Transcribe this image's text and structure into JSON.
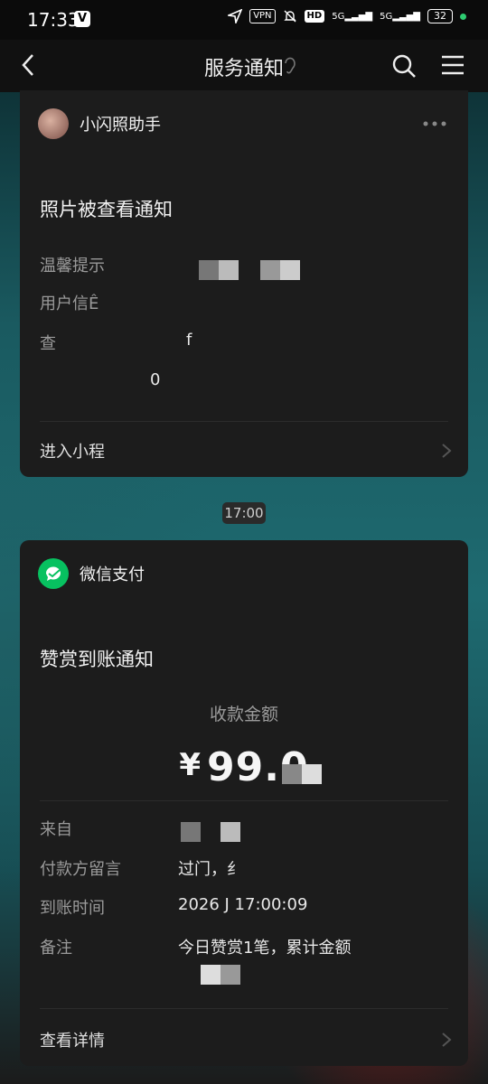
{
  "status_bar": {
    "time": "17:33",
    "app_badge": "V",
    "vpn": "VPN",
    "hd": "HD",
    "signal_1": "5G",
    "signal_2": "5G",
    "battery": "32"
  },
  "nav": {
    "title": "服务通知"
  },
  "card1": {
    "source_name": "小闪照助手",
    "title": "照片被查看通知",
    "rows": [
      {
        "label": "温馨提示",
        "value": ""
      },
      {
        "label": "用户信Ê",
        "value": ""
      },
      {
        "label": "查",
        "value": "f"
      },
      {
        "label": "",
        "value": "0"
      }
    ],
    "link": "进入小程"
  },
  "timestamp": "17:00",
  "card2": {
    "source_name": "微信支付",
    "title": "赞赏到账通知",
    "amount_label": "收款金额",
    "currency": "¥",
    "amount": "99.0",
    "rows": [
      {
        "label": "来自",
        "value": ""
      },
      {
        "label": "付款方留言",
        "value": "过门，纟"
      },
      {
        "label": "到账时间",
        "value": "2026     J 17:00:09"
      },
      {
        "label": "备注",
        "value": "今日赞赏1笔，累计金额"
      }
    ],
    "link": "查看详情"
  },
  "colors": {
    "wechat_green": "#07c160",
    "card_bg": "#1c1c1c"
  }
}
